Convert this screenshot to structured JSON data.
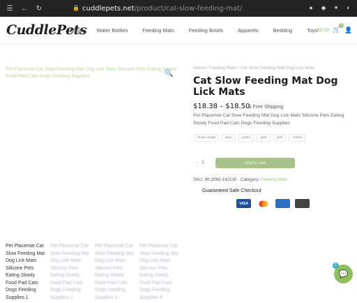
{
  "browser": {
    "url_domain": "cuddlepets.net",
    "url_path": "/product/cat-slow-feeding-mat/",
    "icons": [
      "menu-icon",
      "back-icon",
      "reload-icon",
      "lock-icon",
      "github-icon",
      "shield-icon",
      "extension-icon",
      "profile-icon"
    ]
  },
  "header": {
    "logo": "CuddlePets",
    "nav": [
      "Shop",
      "Water Bottles",
      "Feeding Mats",
      "Feeding Bowls",
      "Apparels",
      "Bedding",
      "Toys"
    ],
    "cart_total": "$0.00",
    "cart_count": "0"
  },
  "gallery": {
    "caption": "Pet Placemat Cat Slow Feeding Mat Dog Lick Mats Silicone Pets Eating Slowly Food Pad Cats Dogs Feeding Supplies"
  },
  "related": [
    {
      "text": "Pet Placemat Cat Slow Feeding Mat Dog Lick Mats Silicone Pets Eating Slowly Food Pad Cats Dogs Feeding Supplies 1"
    },
    {
      "text": "Pet Placemat Cat Slow Feeding Mat Dog Lick Mats Silicone Pets Eating Slowly Food Pad Cats Dogs Feeding Supplies 2"
    },
    {
      "text": "Pet Placemat Cat Slow Feeding Mat Dog Lick Mats Silicone Pets Eating Slowly Food Pad Cats Dogs Feeding Supplies 3"
    },
    {
      "text": "Pet Placemat Cat Slow Feeding Mat Dog Lick Mats Silicone Pets Eating Slowly Food Pad Cats Dogs Feeding Supplies 4"
    }
  ],
  "product": {
    "breadcrumb": "Home / Feeding Mats / Cat Slow Feeding Mat Dog Lick Mats",
    "title": "Cat Slow Feeding Mat Dog Lick Mats",
    "price": "$18.38 – $18.50",
    "shipping": "& Free Shipping",
    "description": "Pet Placemat Cat Slow Feeding Mat Dog Lick Mats Silicone Pets Eating Slowly Food Pad Cats Dogs Feeding Supplies",
    "swatches": [
      "Back-shape",
      "Blue",
      "green",
      "grey",
      "pink",
      "Yellow"
    ],
    "qty_minus": "-",
    "qty_value": "1",
    "add_to_cart": "Add to cart",
    "sku": "SKU: 90-2060-142130",
    "category_label": "Category:",
    "category": "Feeding Mats",
    "checkout_title": "Guaranteed Safe Checkout",
    "payments": [
      "VISA",
      "MC",
      "AMEX",
      "DISCOVER"
    ]
  },
  "chat": {
    "badge": "1",
    "icon": "chat-icon"
  },
  "colors": {
    "accent": "#9bbf7a",
    "button": "#a7c28a",
    "chrome": "#232323"
  }
}
